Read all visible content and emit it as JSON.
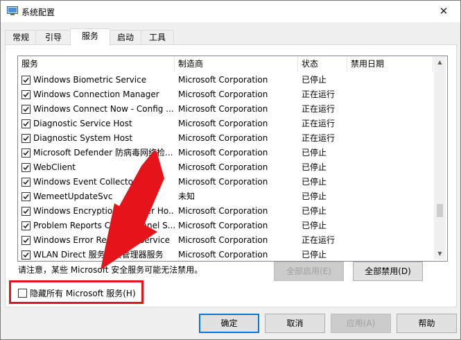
{
  "window": {
    "title": "系统配置",
    "close_glyph": "✕"
  },
  "tabs": [
    {
      "label": "常规"
    },
    {
      "label": "引导"
    },
    {
      "label": "服务"
    },
    {
      "label": "启动"
    },
    {
      "label": "工具"
    }
  ],
  "active_tab": "服务",
  "table": {
    "headers": [
      "服务",
      "制造商",
      "状态",
      "禁用日期"
    ],
    "rows": [
      {
        "name": "Windows Biometric Service",
        "vendor": "Microsoft Corporation",
        "status": "已停止",
        "checked": true
      },
      {
        "name": "Windows Connection Manager",
        "vendor": "Microsoft Corporation",
        "status": "正在运行",
        "checked": true
      },
      {
        "name": "Windows Connect Now - Config ...",
        "vendor": "Microsoft Corporation",
        "status": "正在运行",
        "checked": true
      },
      {
        "name": "Diagnostic Service Host",
        "vendor": "Microsoft Corporation",
        "status": "正在运行",
        "checked": true
      },
      {
        "name": "Diagnostic System Host",
        "vendor": "Microsoft Corporation",
        "status": "正在运行",
        "checked": true
      },
      {
        "name": "Microsoft Defender 防病毒网络检...",
        "vendor": "Microsoft Corporation",
        "status": "已停止",
        "checked": true
      },
      {
        "name": "WebClient",
        "vendor": "Microsoft Corporation",
        "status": "已停止",
        "checked": true
      },
      {
        "name": "Windows Event Collector",
        "vendor": "Microsoft Corporation",
        "status": "已停止",
        "checked": true
      },
      {
        "name": "WemeetUpdateSvc",
        "vendor": "未知",
        "status": "已停止",
        "checked": true
      },
      {
        "name": "Windows Encryption Provider Ho...",
        "vendor": "Microsoft Corporation",
        "status": "已停止",
        "checked": true
      },
      {
        "name": "Problem Reports Control Panel S...",
        "vendor": "Microsoft Corporation",
        "status": "已停止",
        "checked": true
      },
      {
        "name": "Windows Error Reporting Service",
        "vendor": "Microsoft Corporation",
        "status": "正在运行",
        "checked": true
      },
      {
        "name": "WLAN Direct 服务连接管理器服务",
        "vendor": "Microsoft Corporation",
        "status": "已停止",
        "checked": true
      }
    ]
  },
  "scroll": {
    "up_glyph": "▲",
    "down_glyph": "▼"
  },
  "note": "请注意，某些 Microsoft 安全服务可能无法禁用。",
  "buttons": {
    "enable_all": "全部启用(E)",
    "disable_all": "全部禁用(D)",
    "ok": "确定",
    "cancel": "取消",
    "apply": "应用(A)",
    "help": "帮助"
  },
  "hide_ms": {
    "label": "隐藏所有 Microsoft 服务(H)",
    "checked": false
  },
  "colors": {
    "highlight_border": "#e5141b",
    "arrow": "#e5141b",
    "accent": "#0078d7"
  }
}
